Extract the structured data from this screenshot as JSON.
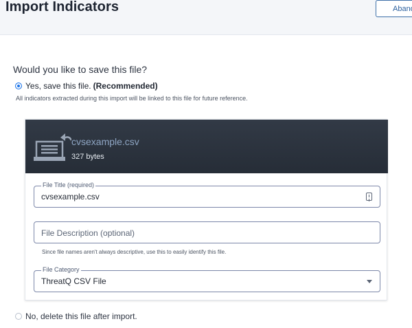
{
  "header": {
    "title": "Import Indicators",
    "abandon_label": "Abandon"
  },
  "save_prompt": {
    "question": "Would you like to save this file?",
    "yes_option": "Yes, save this file.",
    "yes_recommended": "(Recommended)",
    "yes_selected": true,
    "yes_help": "All indicators extracted during this import will be linked to this file for future reference.",
    "no_option": "No, delete this file after import."
  },
  "file": {
    "name": "cvsexample.csv",
    "size": "327 bytes",
    "icon": "file-archive-icon"
  },
  "form": {
    "title_label": "File Title (required)",
    "title_value": "cvsexample.csv",
    "description_placeholder": "File Description (optional)",
    "description_help": "Since file names aren't always descriptive, use this to easily identify this file.",
    "category_label": "File Category",
    "category_value": "ThreatQ CSV File"
  },
  "colors": {
    "accent": "#1a73e8",
    "header_bg": "#2c333e",
    "field_border": "#7b86a8"
  }
}
